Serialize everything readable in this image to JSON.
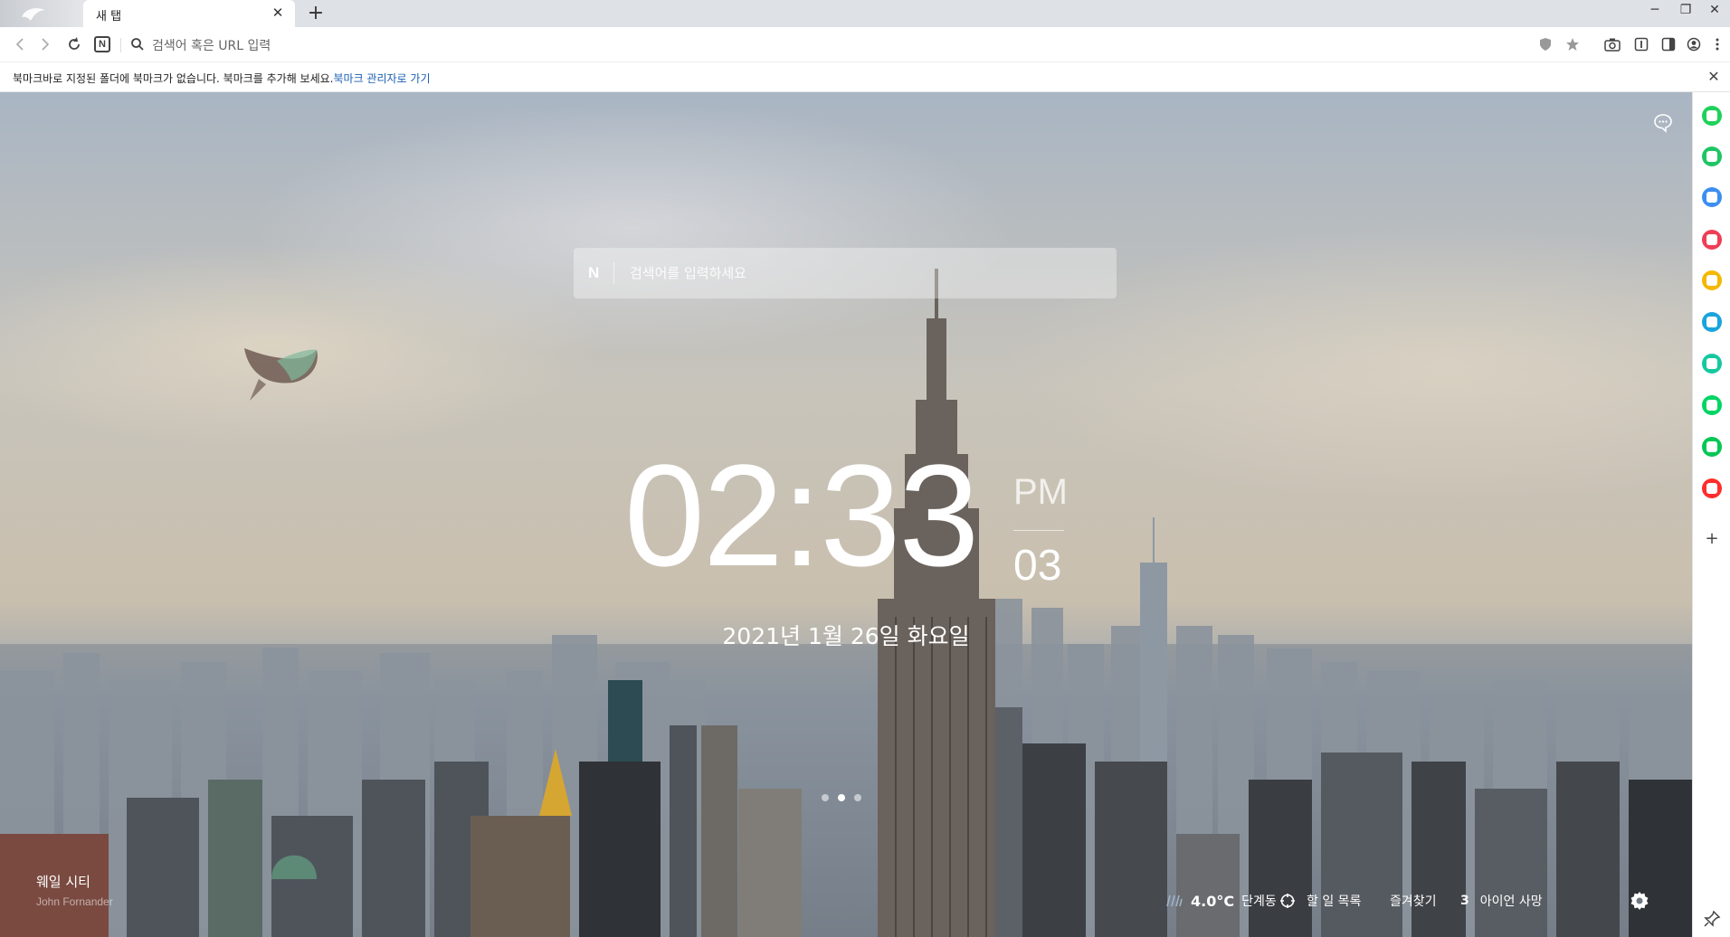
{
  "tab": {
    "title": "새 탭",
    "close": "✕",
    "new_tab": "+"
  },
  "window": {
    "minimize": "─",
    "restore": "❐",
    "close": "✕"
  },
  "toolbar": {
    "address_placeholder": "검색어 혹은 URL 입력",
    "site_badge": "N"
  },
  "bookmark_bar": {
    "message": "북마크바로 지정된 폴더에 북마크가 없습니다. 북마크를 추가해 보세요.",
    "link": "북마크 관리자로 가기",
    "close": "✕"
  },
  "newtab": {
    "search_badge": "N",
    "search_placeholder": "검색어를 입력하세요",
    "clock": {
      "time": "02:33",
      "ampm": "PM",
      "seconds": "03"
    },
    "date": "2021년 1월 26일 화요일",
    "slides": {
      "count": 3,
      "active": 2
    },
    "credit": {
      "title": "웨일 시티",
      "author": "John Fornander"
    },
    "widgets": {
      "weather": {
        "temp": "4.0°C",
        "location": "단계동"
      },
      "todo": "할 일 목록",
      "favorites": "즐겨찾기",
      "count": "3",
      "profile": "아이언 사망"
    }
  },
  "sidebar": {
    "items": [
      {
        "name": "sidebar-green-circle",
        "color": "#1fd15a"
      },
      {
        "name": "sidebar-talk",
        "color": "#20c565"
      },
      {
        "name": "sidebar-calendar",
        "color": "#3d8ef0"
      },
      {
        "name": "sidebar-pocket",
        "color": "#ef3e56"
      },
      {
        "name": "sidebar-star",
        "color": "#f5b800"
      },
      {
        "name": "sidebar-edge",
        "color": "#19a4dd"
      },
      {
        "name": "sidebar-play",
        "color": "#16c8a0"
      },
      {
        "name": "sidebar-webtoon",
        "color": "#00d564"
      },
      {
        "name": "sidebar-line",
        "color": "#06c755"
      },
      {
        "name": "sidebar-now",
        "color": "#ff2d2d"
      }
    ],
    "add": "+"
  }
}
